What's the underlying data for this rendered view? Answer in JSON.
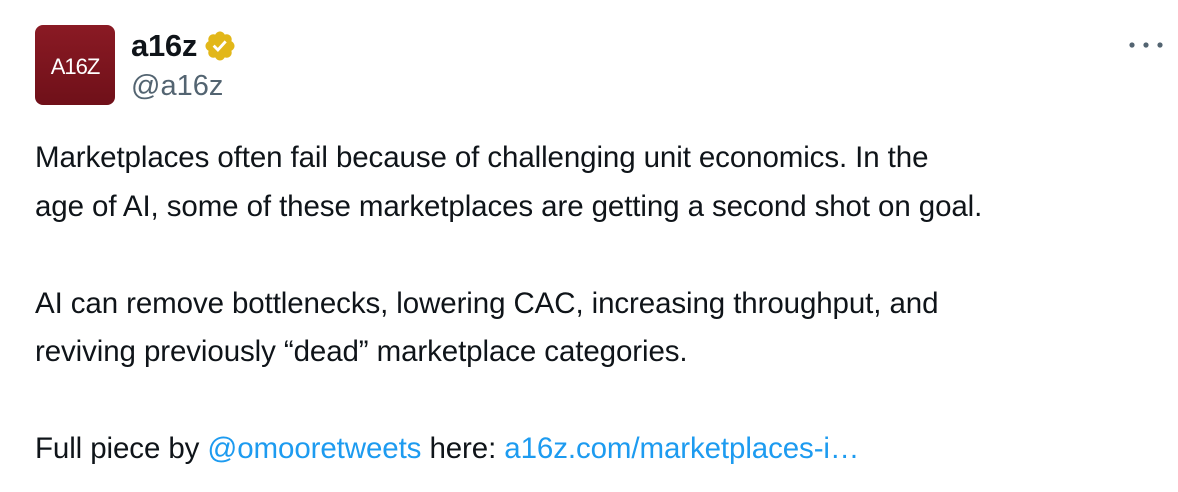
{
  "author": {
    "avatar_text": "A16Z",
    "display_name": "a16z",
    "handle": "@a16z",
    "verified_badge_icon": "verified-gold-badge-icon",
    "badge_color": "#e2b719"
  },
  "more_icon": "more-horizontal-icon",
  "tweet": {
    "para1_line1": "Marketplaces often fail because of challenging unit economics. In the",
    "para1_line2": "age of AI, some of these marketplaces are getting a second shot on goal.",
    "para2_line1": "AI can remove bottlenecks, lowering CAC, increasing throughput, and",
    "para2_line2": "reviving previously “dead” marketplace categories.",
    "para3_prefix": "Full piece by ",
    "mention": "@omooretweets",
    "para3_middle": " here: ",
    "link": "a16z.com/marketplaces-i…"
  },
  "colors": {
    "text": "#0f1419",
    "secondary": "#536471",
    "link": "#1d9bf0",
    "avatar_bg": "#7d1520"
  }
}
